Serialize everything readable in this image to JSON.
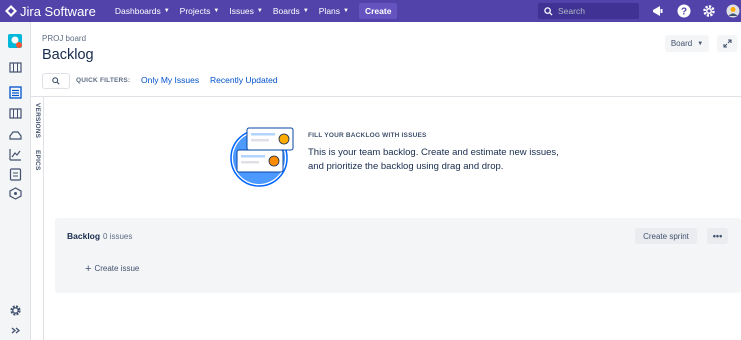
{
  "topnav": {
    "logo_text": "Jira Software",
    "items": [
      "Dashboards",
      "Projects",
      "Issues",
      "Boards",
      "Plans"
    ],
    "create_label": "Create",
    "search_placeholder": "Search",
    "bg_color": "#5243aa"
  },
  "sidebar": {
    "icons": [
      "project-avatar-icon",
      "roadmap-icon",
      "backlog-icon",
      "board-icon",
      "releases-icon",
      "reports-icon",
      "pages-icon",
      "components-icon",
      "settings-icon",
      "expand-icon"
    ]
  },
  "vertical_tabs": [
    "VERSIONS",
    "EPICS"
  ],
  "header": {
    "breadcrumb": "PROJ board",
    "title": "Backlog",
    "board_button": "Board"
  },
  "filters": {
    "label": "QUICK FILTERS:",
    "items": [
      "Only My Issues",
      "Recently Updated"
    ]
  },
  "empty_state": {
    "heading": "FILL YOUR BACKLOG WITH ISSUES",
    "line1": "This is your team backlog. Create and estimate new issues,",
    "line2": "and prioritize the backlog using drag and drop."
  },
  "backlog": {
    "title": "Backlog",
    "count": "0 issues",
    "create_sprint": "Create sprint",
    "more": "•••",
    "create_issue": "Create issue"
  }
}
